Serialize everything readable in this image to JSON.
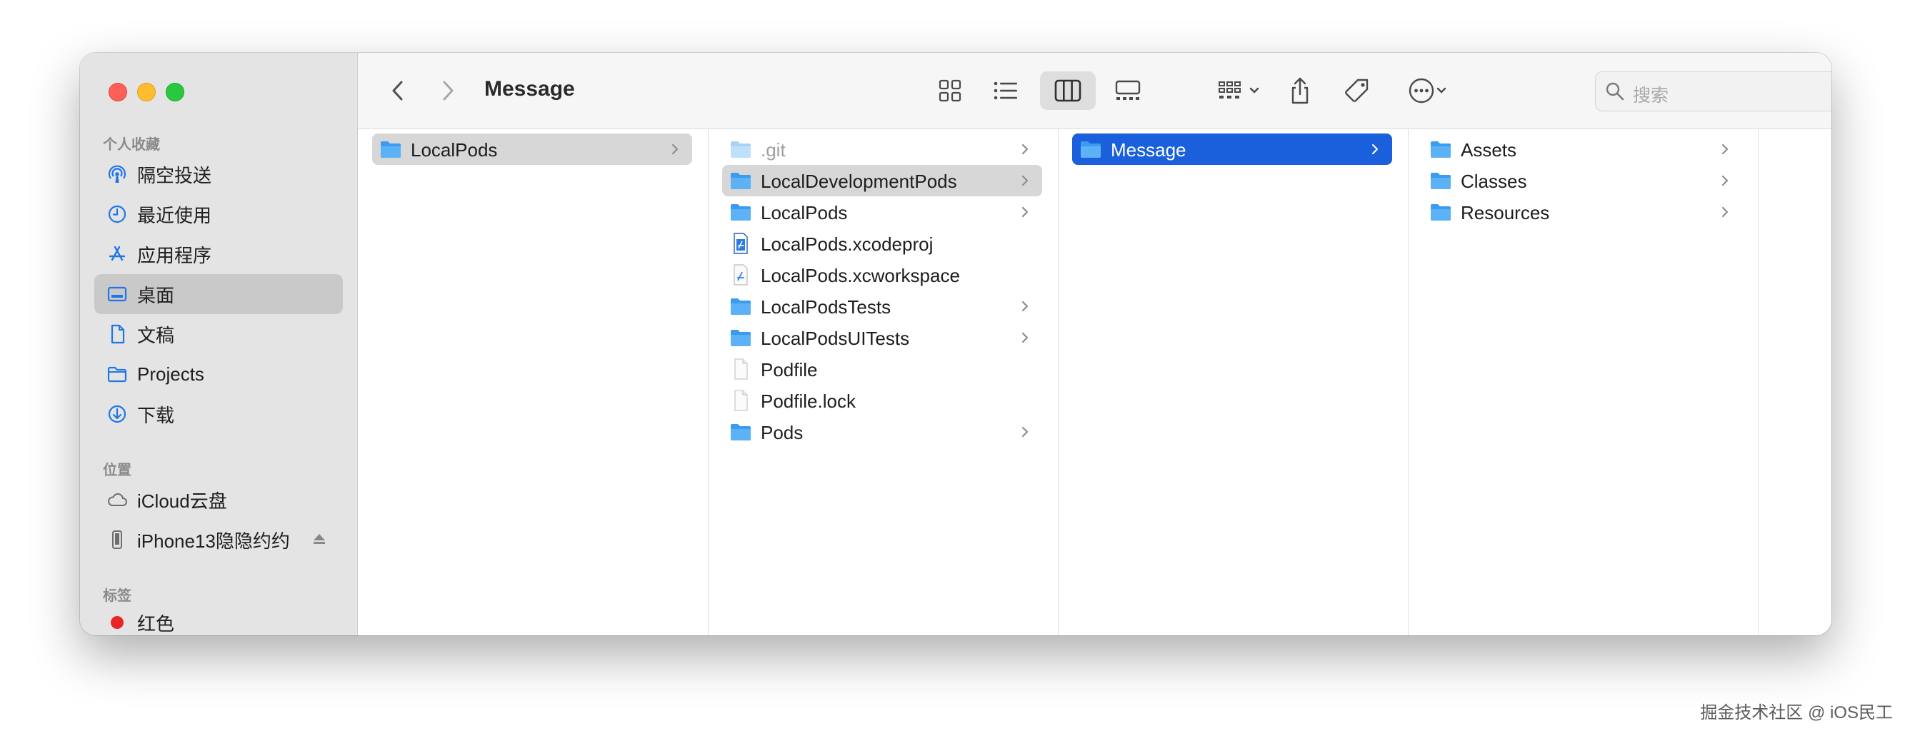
{
  "window": {
    "title": "Message"
  },
  "sidebar": {
    "favorites_title": "个人收藏",
    "favorites": [
      {
        "label": "隔空投送",
        "icon": "airdrop-icon"
      },
      {
        "label": "最近使用",
        "icon": "clock-icon"
      },
      {
        "label": "应用程序",
        "icon": "apps-icon"
      },
      {
        "label": "桌面",
        "icon": "desktop-icon",
        "selected": true
      },
      {
        "label": "文稿",
        "icon": "document-icon"
      },
      {
        "label": "Projects",
        "icon": "folder-icon"
      },
      {
        "label": "下载",
        "icon": "download-icon"
      }
    ],
    "locations_title": "位置",
    "locations": [
      {
        "label": "iCloud云盘",
        "icon": "cloud-icon"
      },
      {
        "label": "iPhone13隐隐约约",
        "icon": "iphone-icon"
      }
    ],
    "tags_title": "标签",
    "tags": [
      {
        "label": "红色",
        "color": "#e8262a"
      }
    ]
  },
  "search": {
    "placeholder": "搜索"
  },
  "columns": [
    {
      "items": [
        {
          "label": "LocalPods",
          "type": "folder",
          "state": "selected-inactive",
          "chevron": true
        }
      ]
    },
    {
      "items": [
        {
          "label": ".git",
          "type": "folder",
          "state": "dim",
          "chevron": true
        },
        {
          "label": "LocalDevelopmentPods",
          "type": "folder",
          "state": "selected-inactive",
          "chevron": true
        },
        {
          "label": "LocalPods",
          "type": "folder",
          "chevron": true
        },
        {
          "label": "LocalPods.xcodeproj",
          "type": "xcodeproj",
          "chevron": false
        },
        {
          "label": "LocalPods.xcworkspace",
          "type": "xcworkspace",
          "chevron": false
        },
        {
          "label": "LocalPodsTests",
          "type": "folder",
          "chevron": true
        },
        {
          "label": "LocalPodsUITests",
          "type": "folder",
          "chevron": true
        },
        {
          "label": "Podfile",
          "type": "file",
          "chevron": false
        },
        {
          "label": "Podfile.lock",
          "type": "file",
          "chevron": false
        },
        {
          "label": "Pods",
          "type": "folder",
          "chevron": true
        }
      ]
    },
    {
      "items": [
        {
          "label": "Message",
          "type": "folder",
          "state": "selected-active",
          "chevron": true
        }
      ]
    },
    {
      "items": [
        {
          "label": "Assets",
          "type": "folder",
          "chevron": true
        },
        {
          "label": "Classes",
          "type": "folder",
          "chevron": true
        },
        {
          "label": "Resources",
          "type": "folder",
          "chevron": true
        }
      ]
    }
  ],
  "watermark": "掘金技术社区 @ iOS民工",
  "colors": {
    "accent": "#1a5fdc",
    "folder": "#3a9bf0",
    "sidebar_icon": "#1f76e8"
  }
}
